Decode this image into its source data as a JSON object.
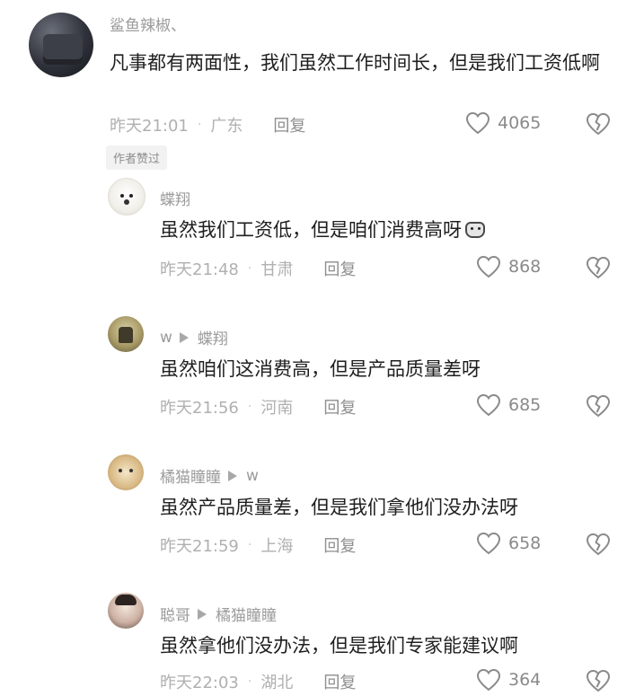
{
  "comments": [
    {
      "username": "鲨鱼辣椒、",
      "content": "凡事都有两面性，我们虽然工作时间长，但是我们工资低啊",
      "time": "昨天21:01",
      "separator": "·",
      "location": "广东",
      "reply_label": "回复",
      "likes": "4065",
      "author_badge": "作者赞过"
    }
  ],
  "replies": [
    {
      "username": "蝶翔",
      "reply_to": "",
      "content": "虽然我们工资低，但是咱们消费高呀",
      "time": "昨天21:48",
      "separator": "·",
      "location": "甘肃",
      "reply_label": "回复",
      "likes": "868"
    },
    {
      "username": "w",
      "reply_to": "蝶翔",
      "content": "虽然咱们这消费高，但是产品质量差呀",
      "time": "昨天21:56",
      "separator": "·",
      "location": "河南",
      "reply_label": "回复",
      "likes": "685"
    },
    {
      "username": "橘猫瞳瞳",
      "reply_to": "w",
      "content": "虽然产品质量差，但是我们拿他们没办法呀",
      "time": "昨天21:59",
      "separator": "·",
      "location": "上海",
      "reply_label": "回复",
      "likes": "658"
    },
    {
      "username": "聪哥",
      "reply_to": "橘猫瞳瞳",
      "content": "虽然拿他们没办法，但是我们专家能建议啊",
      "time": "昨天22:03",
      "separator": "·",
      "location": "湖北",
      "reply_label": "回复",
      "likes": "364"
    }
  ],
  "icons": {
    "like": "heart-outline-icon",
    "dislike": "broken-heart-icon",
    "reply_arrow": "play-arrow-icon",
    "emoji": "cat-face-emoji-icon"
  },
  "colors": {
    "text": "#1f1f1f",
    "muted": "#9b9b9b",
    "icon": "#8a8a8a"
  }
}
